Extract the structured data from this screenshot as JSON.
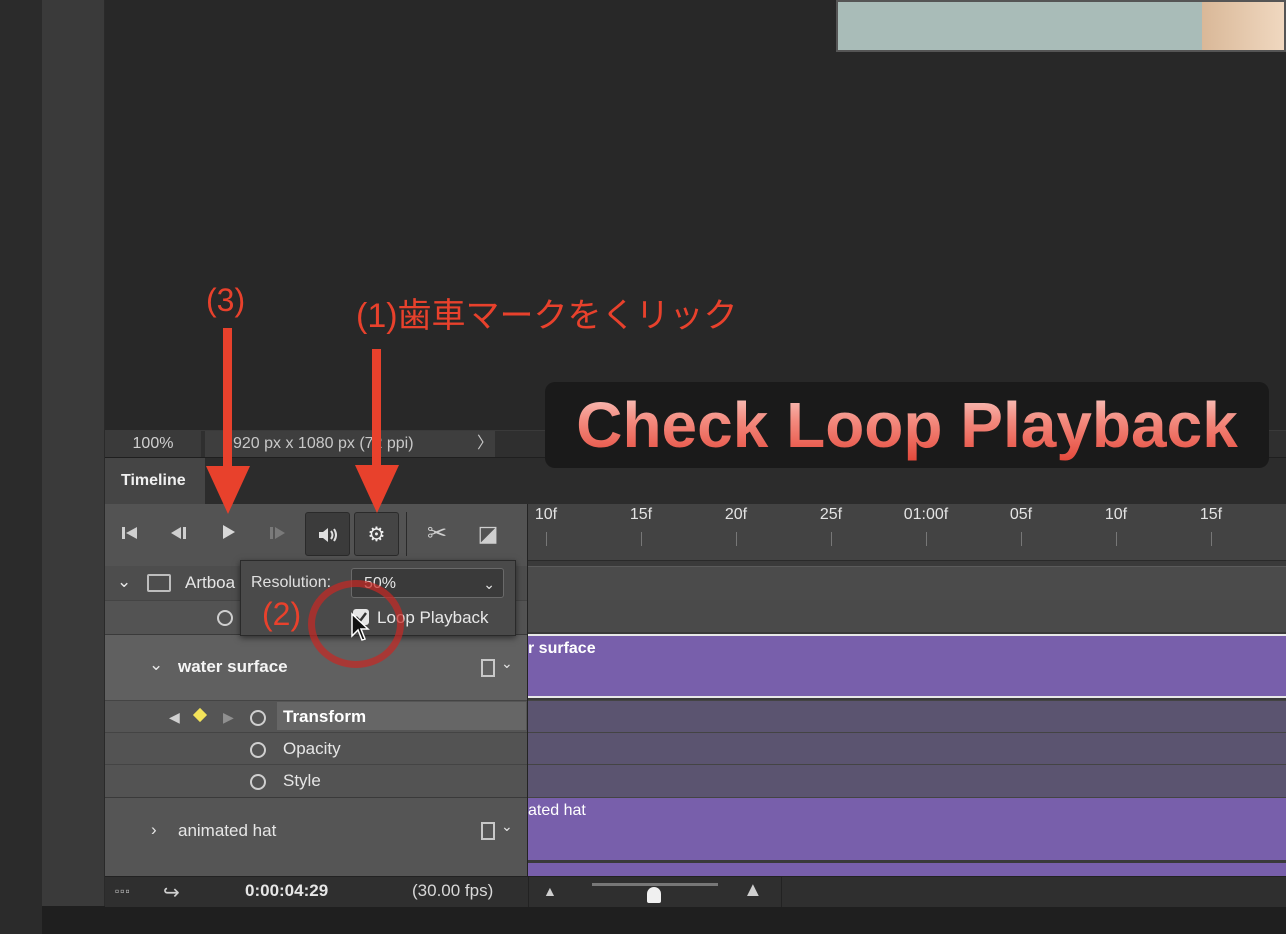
{
  "statusbar": {
    "zoom": "100%",
    "doc_size": "920 px x 1080 px (72 ppi)",
    "more_glyph": "〉"
  },
  "timeline": {
    "tab_label": "Timeline",
    "controls": {
      "first_frame": "⏮",
      "prev_frame": "◂",
      "play": "▶",
      "next_frame": "▸",
      "audio": "🔊",
      "settings": "⚙",
      "split": "✂",
      "transition": "◪"
    },
    "ruler_ticks": [
      "10f",
      "15f",
      "20f",
      "25f",
      "01:00f",
      "05f",
      "10f",
      "15f"
    ]
  },
  "popup": {
    "resolution_label": "Resolution:",
    "resolution_value": "50%",
    "loop_label": "Loop Playback",
    "loop_checked": true
  },
  "layers": {
    "artboard": {
      "name": "Artboa"
    },
    "water_surface": {
      "name": "water surface",
      "clip_label": "r surface"
    },
    "properties": [
      "Transform",
      "Opacity",
      "Style"
    ],
    "animated_hat": {
      "name": "animated hat",
      "clip_label": "ated hat"
    }
  },
  "bottom_bar": {
    "timecode": "0:00:04:29",
    "fps": "(30.00 fps)"
  },
  "annotations": {
    "step1": "(1)歯車マークをくリック",
    "step2": "(2)",
    "step3": "(3)",
    "banner": "Check Loop Playback"
  },
  "colors": {
    "annotation_red": "#e8412c",
    "clip_purple": "#7a5fa8",
    "keyframe_yellow": "#f3e35a"
  }
}
